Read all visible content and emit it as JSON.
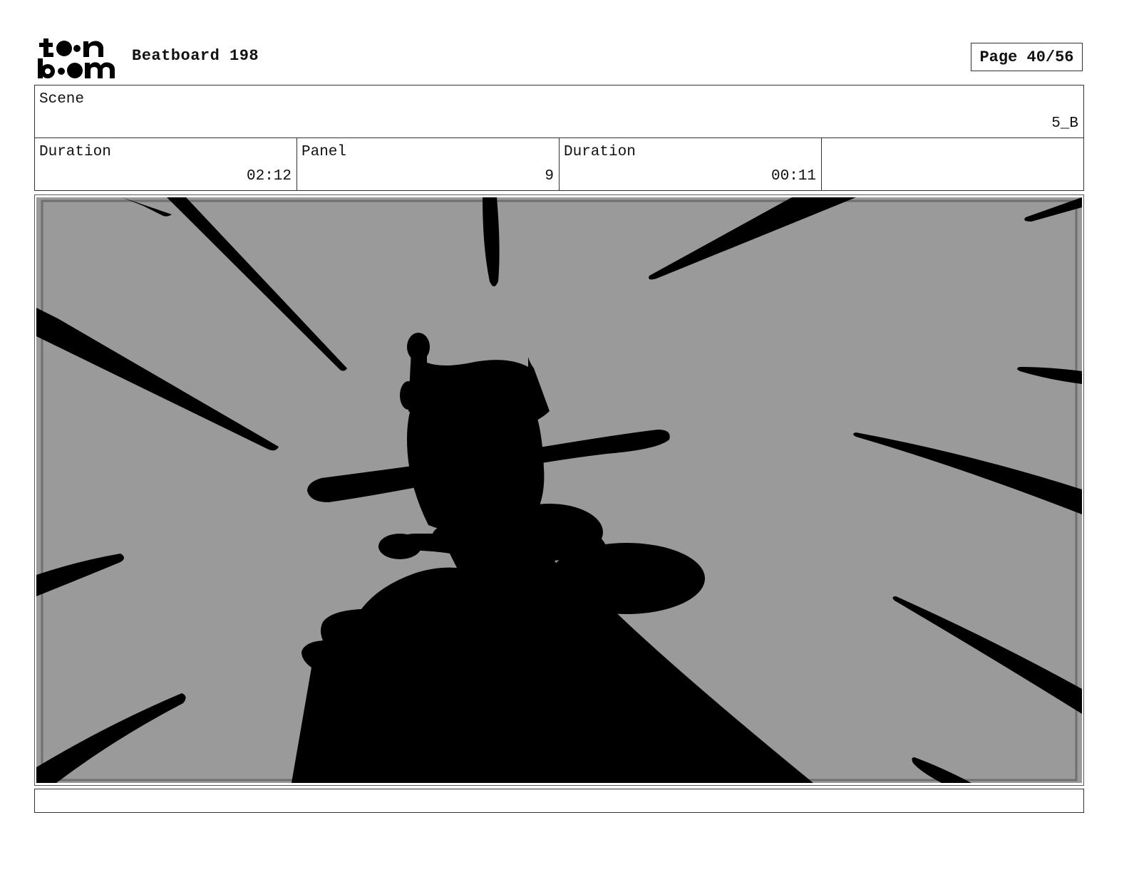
{
  "header": {
    "logo_name": "toon boom",
    "title": "Beatboard 198",
    "page": "Page 40/56"
  },
  "scene": {
    "label": "Scene",
    "value": "5_B"
  },
  "info": {
    "duration_label": "Duration",
    "duration_value": "02:12",
    "panel_label": "Panel",
    "panel_value": "9",
    "panel_duration_label": "Duration",
    "panel_duration_value": "00:11"
  },
  "panel_image": {
    "description_icon": "silhouette-figure-with-hat",
    "background_color": "#9a9a9a",
    "ink_color": "#000000"
  },
  "notes": {
    "text": ""
  }
}
